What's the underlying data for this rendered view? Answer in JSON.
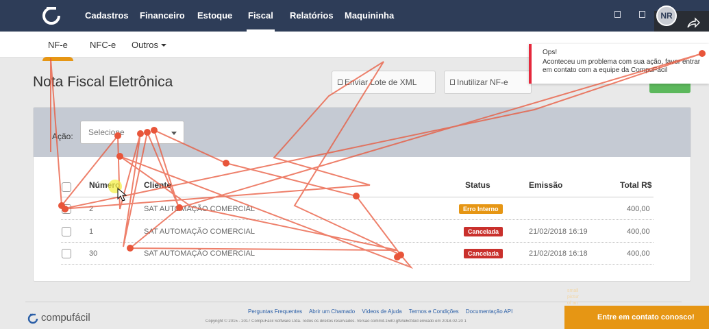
{
  "nav": {
    "items": [
      "Cadastros",
      "Financeiro",
      "Estoque",
      "Fiscal",
      "Relatórios",
      "Maquininha"
    ],
    "active": "Fiscal",
    "avatar_initials": "NR"
  },
  "subnav": {
    "nfe": "NF-e",
    "nfce": "NFC-e",
    "outros": "Outros"
  },
  "page": {
    "title": "Nota Fiscal Eletrônica",
    "btn_enviar_lote": "Enviar Lote de XML",
    "btn_inutilizar": "Inutilizar NF-e"
  },
  "toast": {
    "title": "Ops!",
    "message": "Aconteceu um problema com sua ação, favor entrar em contato com a equipe da CompuFácil",
    "accent": "#e5283c"
  },
  "filter": {
    "acao_label": "Ação:",
    "select_value": "Selecione"
  },
  "table": {
    "headers": {
      "numero": "Número",
      "cliente": "Cliente",
      "status": "Status",
      "emissao": "Emissão",
      "total": "Total R$"
    },
    "rows": [
      {
        "numero": "2",
        "cliente": "SAT AUTOMAÇÃO COMERCIAL",
        "status": "Erro Interno",
        "status_color": "#e69614",
        "emissao": "",
        "total": "400,00"
      },
      {
        "numero": "1",
        "cliente": "SAT AUTOMAÇÃO COMERCIAL",
        "status": "Cancelada",
        "status_color": "#c9302c",
        "emissao": "21/02/2018 16:19",
        "total": "400,00"
      },
      {
        "numero": "30",
        "cliente": "SAT AUTOMAÇÃO COMERCIAL",
        "status": "Cancelada",
        "status_color": "#c9302c",
        "emissao": "21/02/2018 16:18",
        "total": "400,00"
      }
    ]
  },
  "footer": {
    "brand": "compufácil",
    "links": [
      "Perguntas Frequentes",
      "Abrir um Chamado",
      "Vídeos de Ajuda",
      "Termos e Condições",
      "Documentação API"
    ],
    "copyright": "Copyright © 2015 - 2017 CompuFácil Software Ltda. Todos os direitos reservados. Versão commit-1580-gf94e6cf3ed enviado em 2018-02-20 1",
    "contact_button": "Entre em contato conosco!",
    "contact_small": "small pictur of an"
  },
  "colors": {
    "navbar": "#2e3d58",
    "accent_orange": "#e69614",
    "panel_head": "#c5cad3",
    "trace": "#e8553a"
  }
}
